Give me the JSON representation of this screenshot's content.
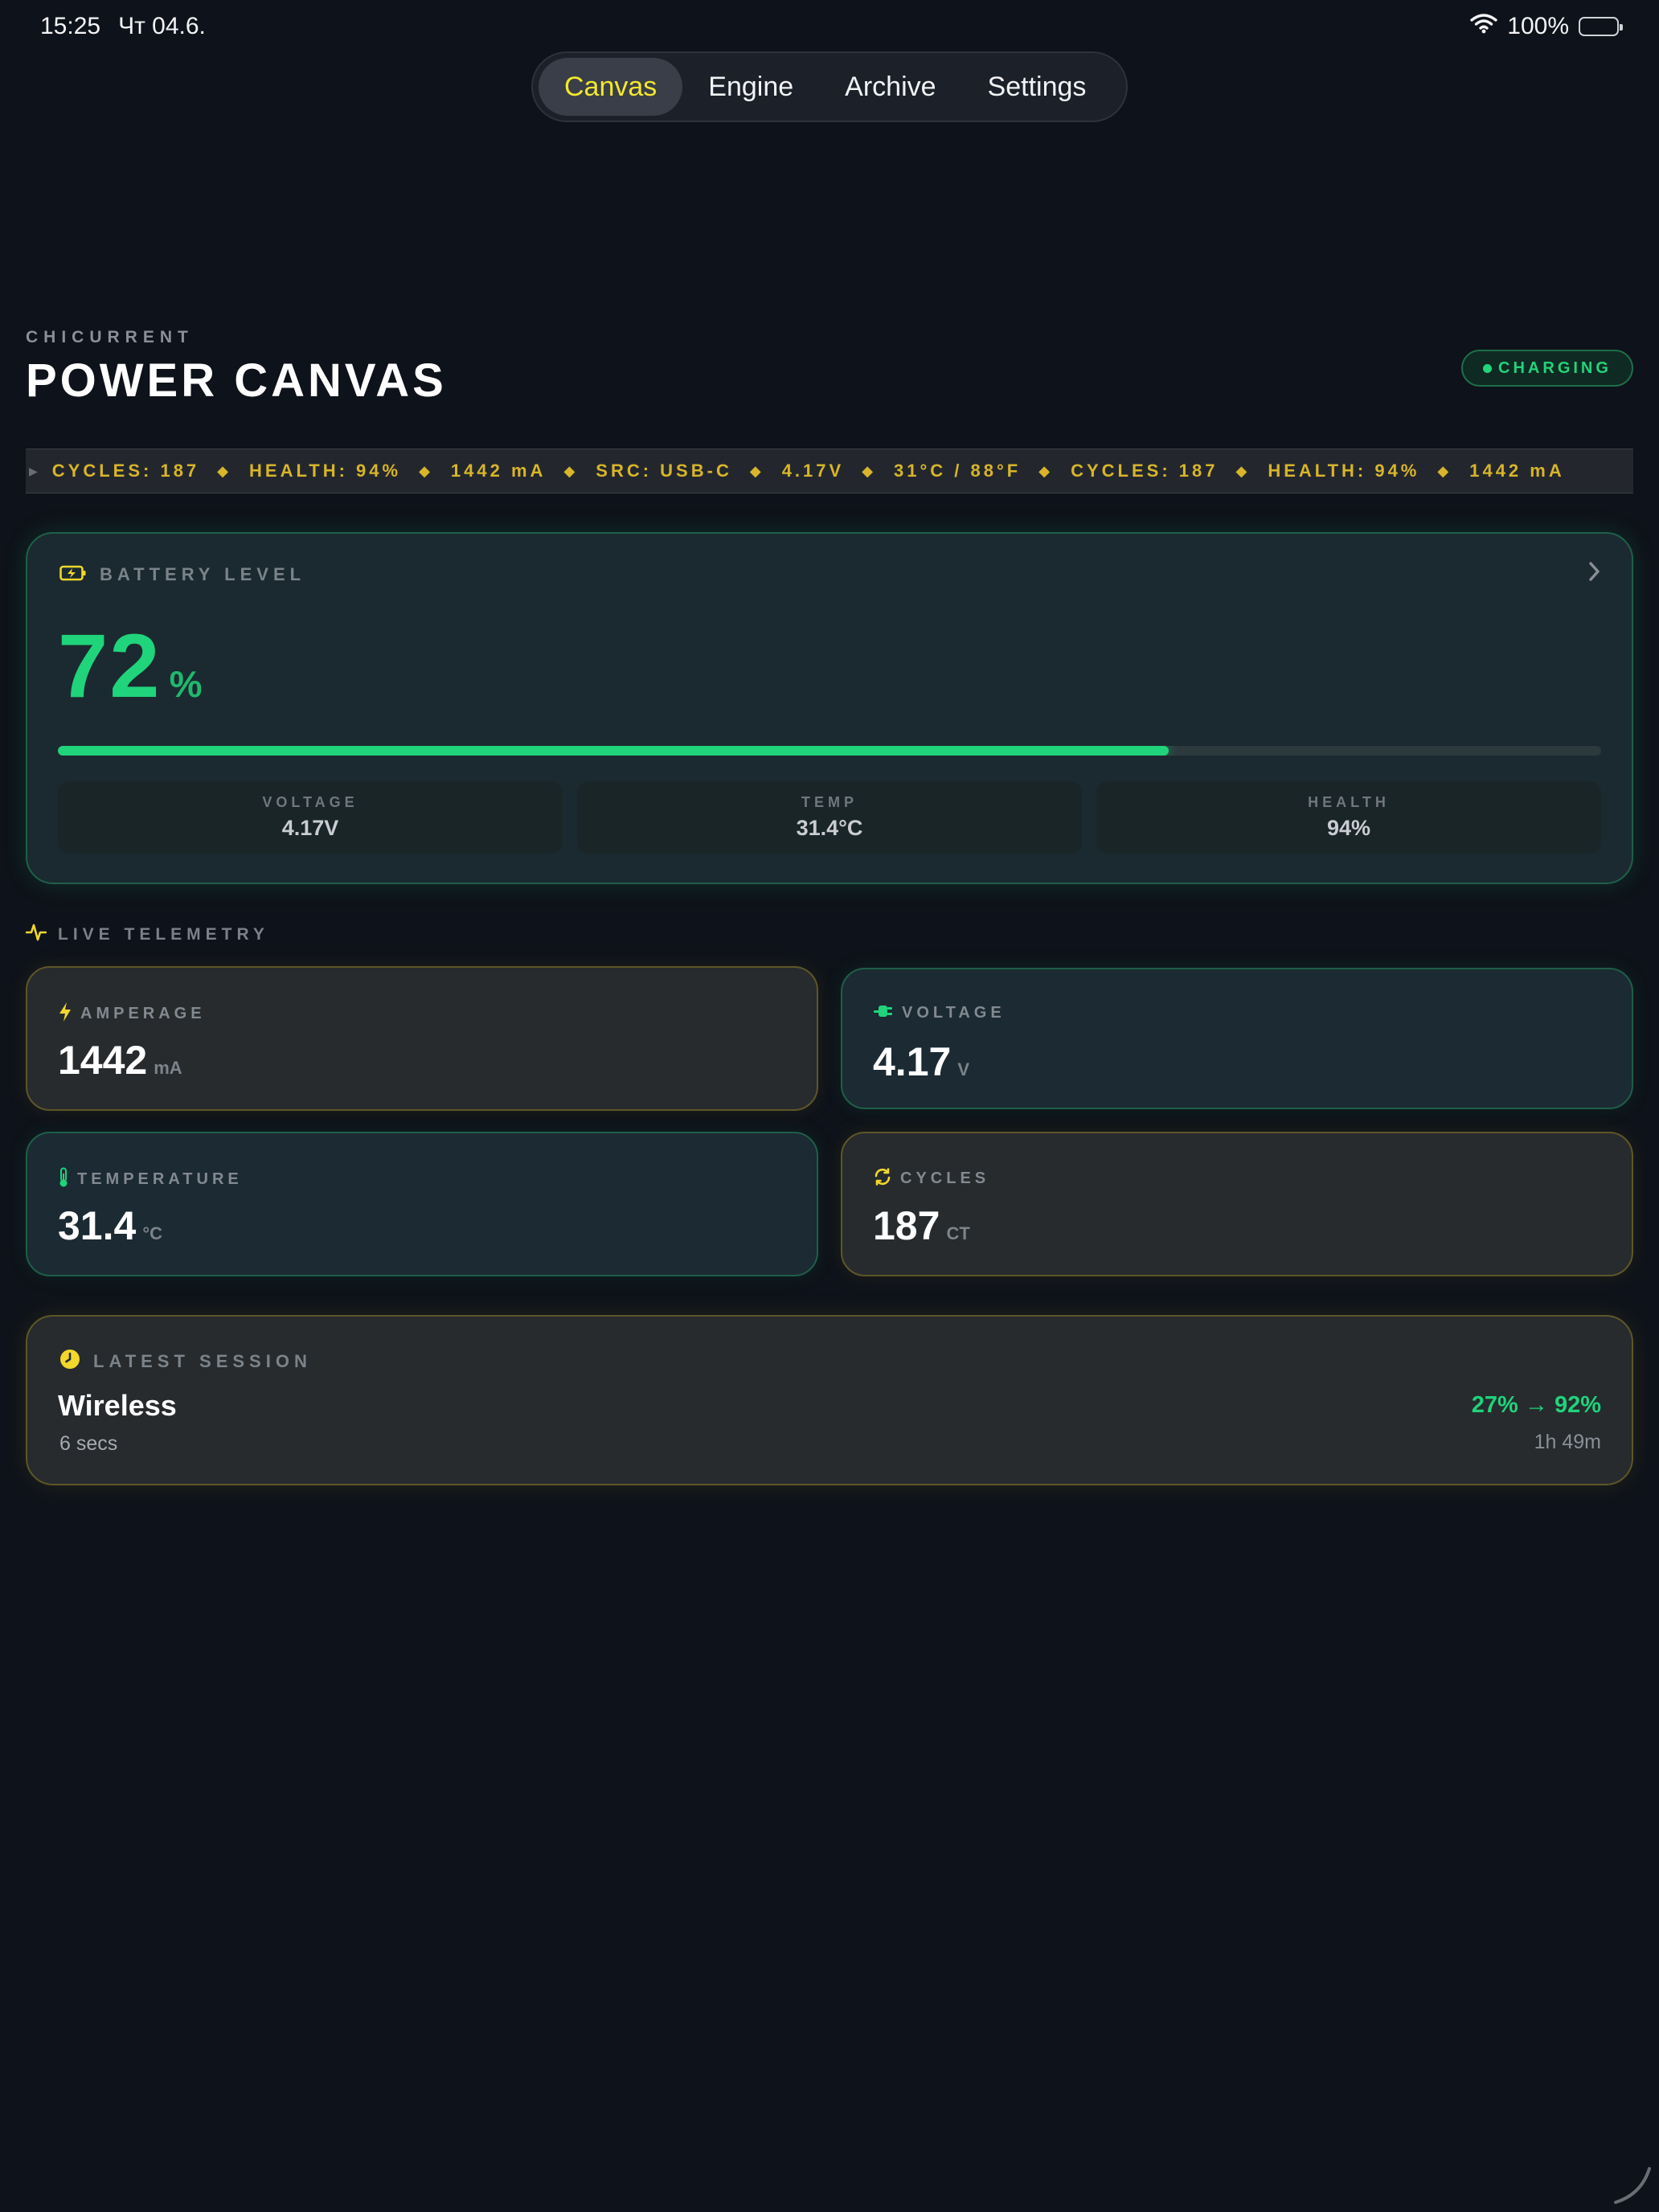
{
  "status_bar": {
    "time": "15:25",
    "date": "Чт 04.6.",
    "battery_percent": "100%",
    "icons": [
      "wifi-icon",
      "battery-icon"
    ]
  },
  "tabs": [
    {
      "label": "Canvas",
      "active": true
    },
    {
      "label": "Engine",
      "active": false
    },
    {
      "label": "Archive",
      "active": false
    },
    {
      "label": "Settings",
      "active": false
    }
  ],
  "header": {
    "kicker": "CHICURRENT",
    "title": "POWER CANVAS",
    "badge": "CHARGING"
  },
  "ticker": {
    "items": [
      "CYCLES: 187",
      "HEALTH: 94%",
      "1442 mA",
      "SRC: USB-C",
      "4.17V",
      "31°C / 88°F",
      "CYCLES: 187",
      "HEALTH: 94%",
      "1442 mA"
    ],
    "separator": "◆"
  },
  "battery_card": {
    "label": "BATTERY LEVEL",
    "value": "72",
    "unit": "%",
    "level_fraction": 0.72,
    "stats": [
      {
        "label": "VOLTAGE",
        "value": "4.17V"
      },
      {
        "label": "TEMP",
        "value": "31.4°C"
      },
      {
        "label": "HEALTH",
        "value": "94%"
      }
    ]
  },
  "telemetry": {
    "label": "LIVE TELEMETRY",
    "tiles": [
      {
        "label": "AMPERAGE",
        "value": "1442",
        "unit": "mA",
        "icon": "bolt-icon"
      },
      {
        "label": "VOLTAGE",
        "value": "4.17",
        "unit": "V",
        "icon": "plug-icon"
      },
      {
        "label": "TEMPERATURE",
        "value": "31.4",
        "unit": "°C",
        "icon": "thermometer-icon"
      },
      {
        "label": "CYCLES",
        "value": "187",
        "unit": "CT",
        "icon": "cycle-icon"
      }
    ]
  },
  "session": {
    "label": "LATEST SESSION",
    "name": "Wireless",
    "duration": "6 secs",
    "range": "27% → 92%",
    "time": "1h 49m"
  },
  "colors": {
    "background": "#0e121a",
    "accent_green": "#1fd47b",
    "accent_yellow": "#f2e82c",
    "ticker_yellow": "#d8b52a"
  }
}
